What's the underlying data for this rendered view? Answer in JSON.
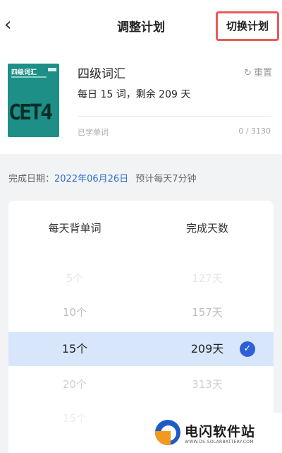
{
  "header": {
    "back_glyph": "‹",
    "title": "调整计划",
    "switch_label": "切换计划"
  },
  "book": {
    "cover_title": "四级词汇",
    "cover_big": "CET4",
    "name": "四级词汇",
    "reset_icon": "↻",
    "reset_label": "重置",
    "daily_info": "每日 15 词，剩余 209 天",
    "learned_label": "已学单词",
    "learned_count": "0 / 3130"
  },
  "completion": {
    "label": "完成日期：",
    "date": "2022年06月26日",
    "estimate": "预计每天7分钟"
  },
  "plan": {
    "col_words": "每天背单词",
    "col_days": "完成天数",
    "options": [
      {
        "words": "5个",
        "days": "127天"
      },
      {
        "words": "10个",
        "days": "157天"
      },
      {
        "words": "15个",
        "days": "209天",
        "selected": true
      },
      {
        "words": "20个",
        "days": "313天"
      },
      {
        "words": "15个",
        "days": "157天"
      }
    ],
    "check_glyph": "✓"
  },
  "watermark": {
    "name": "电闪软件站",
    "url": "WWW.DS-SOLARBATTERY.COM"
  },
  "colors": {
    "accent": "#2b6fd1",
    "selected_row": "#d8e6fb",
    "highlight_border": "#e85a5a",
    "cover": "#1d8f86"
  }
}
